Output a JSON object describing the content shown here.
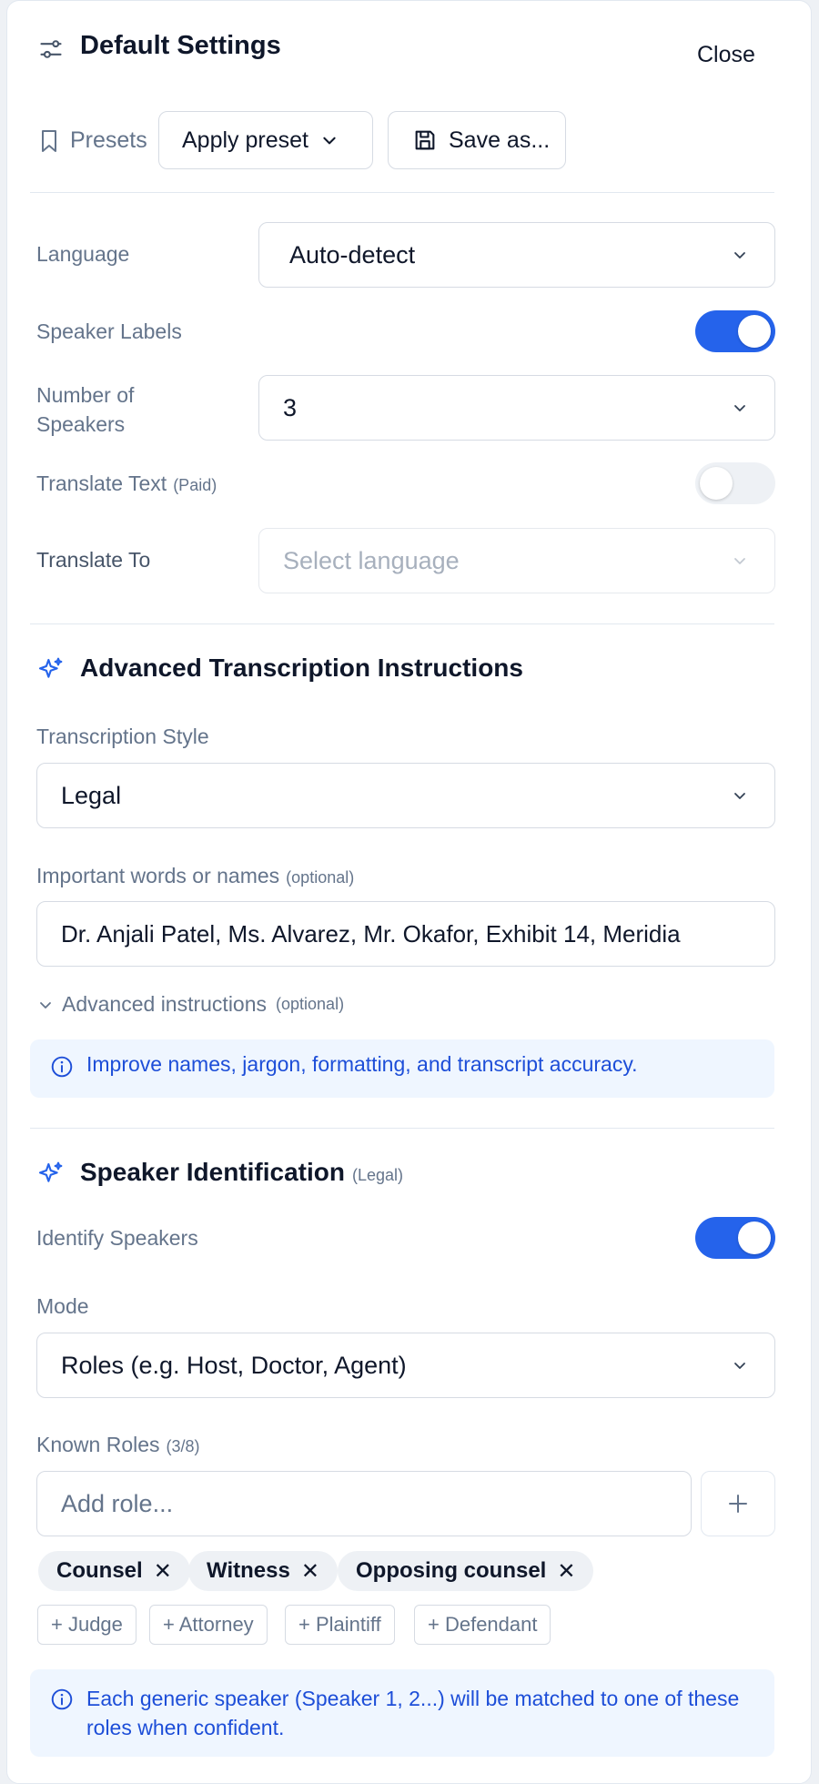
{
  "header": {
    "title": "Default Settings",
    "close_label": "Close"
  },
  "presets": {
    "label": "Presets",
    "apply_label": "Apply preset",
    "save_label": "Save as..."
  },
  "settings": {
    "language_label": "Language",
    "language_value": "Auto-detect",
    "speaker_labels_label": "Speaker Labels",
    "speaker_labels_on": true,
    "num_speakers_label_line1": "Number of",
    "num_speakers_label_line2": "Speakers",
    "num_speakers_value": "3",
    "translate_label": "Translate Text",
    "translate_tag": "(Paid)",
    "translate_on": false,
    "translate_to_label": "Translate To",
    "translate_to_placeholder": "Select language"
  },
  "advanced": {
    "title": "Advanced Transcription Instructions",
    "style_label": "Transcription Style",
    "style_value": "Legal",
    "words_label": "Important words or names",
    "words_optional": "(optional)",
    "words_value": "Dr. Anjali Patel, Ms. Alvarez, Mr. Okafor, Exhibit 14, Meridia",
    "instructions_label": "Advanced instructions",
    "instructions_optional": "(optional)",
    "info_text": "Improve names, jargon, formatting, and transcript accuracy."
  },
  "speaker_id": {
    "title": "Speaker Identification",
    "title_tag": "(Legal)",
    "identify_label": "Identify Speakers",
    "identify_on": true,
    "mode_label": "Mode",
    "mode_value": "Roles (e.g. Host, Doctor, Agent)",
    "roles_label": "Known Roles",
    "roles_count": "(3/8)",
    "add_role_placeholder": "Add role...",
    "roles": [
      "Counsel",
      "Witness",
      "Opposing counsel"
    ],
    "suggestions": [
      "+ Judge",
      "+ Attorney",
      "+ Plaintiff",
      "+ Defendant"
    ],
    "info_text": "Each generic speaker (Speaker 1, 2...) will be matched to one of these roles when confident."
  },
  "colors": {
    "accent": "#2563eb",
    "info_bg": "#eff6ff",
    "info_text": "#1d4ed8"
  }
}
